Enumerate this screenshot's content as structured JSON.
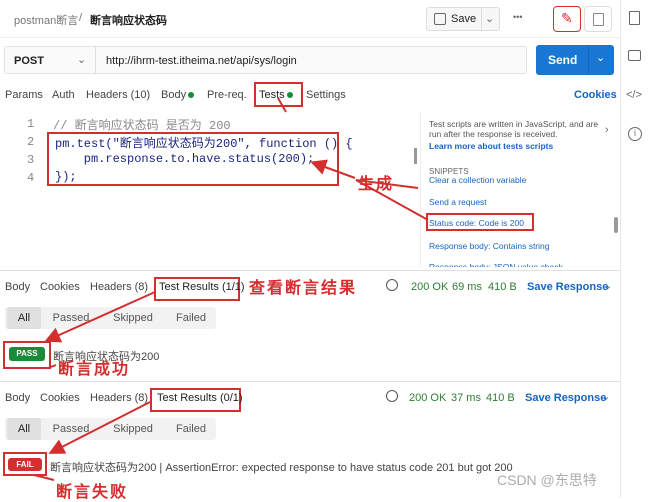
{
  "header": {
    "breadcrumb_root": "postman断言",
    "sep": "/",
    "title": "断言响应状态码",
    "save": "Save",
    "more": "•••"
  },
  "request": {
    "method": "POST",
    "url": "http://ihrm-test.itheima.net/api/sys/login",
    "send": "Send"
  },
  "req_tabs": {
    "params": "Params",
    "auth": "Auth",
    "headers": "Headers (10)",
    "body": "Body",
    "prereq": "Pre-req.",
    "tests": "Tests",
    "settings": "Settings",
    "cookies": "Cookies"
  },
  "editor": {
    "lines": [
      {
        "num": "1",
        "text": "// 断言响应状态码 是否为 200"
      },
      {
        "num": "2",
        "text": "pm.test(\"断言响应状态码为200\", function () {"
      },
      {
        "num": "3",
        "text": "    pm.response.to.have.status(200);"
      },
      {
        "num": "4",
        "text": "});"
      }
    ]
  },
  "right_panel": {
    "desc": "Test scripts are written in JavaScript, and are run after the response is received.",
    "learn": "Learn more about tests scripts",
    "snippets_title": "SNIPPETS",
    "snippets": [
      "Clear a collection variable",
      "Send a request",
      "Status code: Code is 200",
      "Response body: Contains string",
      "Response body: JSON value check"
    ]
  },
  "response1": {
    "body": "Body",
    "cookies": "Cookies",
    "headers": "Headers (8)",
    "test_results": "Test Results (1/1)",
    "status": "200 OK",
    "time": "69 ms",
    "size": "410 B",
    "save": "Save Response",
    "filters": [
      "All",
      "Passed",
      "Skipped",
      "Failed"
    ],
    "badge": "PASS",
    "result": "断言响应状态码为200"
  },
  "response2": {
    "body": "Body",
    "cookies": "Cookies",
    "headers": "Headers (8)",
    "test_results": "Test Results (0/1)",
    "status": "200 OK",
    "time": "37 ms",
    "size": "410 B",
    "save": "Save Response",
    "filters": [
      "All",
      "Passed",
      "Skipped",
      "Failed"
    ],
    "badge": "FAIL",
    "result": "断言响应状态码为200 | AssertionError: expected response to have status code 201 but got 200"
  },
  "annotations": {
    "generate": "生成",
    "view": "查看断言结果",
    "success": "断言成功",
    "fail": "断言失败"
  },
  "watermark": "CSDN @东思特",
  "colors": {
    "send": "#1976d2",
    "pass": "#1b8a3a",
    "fail": "#d32f2f",
    "annotation": "#d32f2f",
    "tests_dot": "#1b8a3a"
  }
}
